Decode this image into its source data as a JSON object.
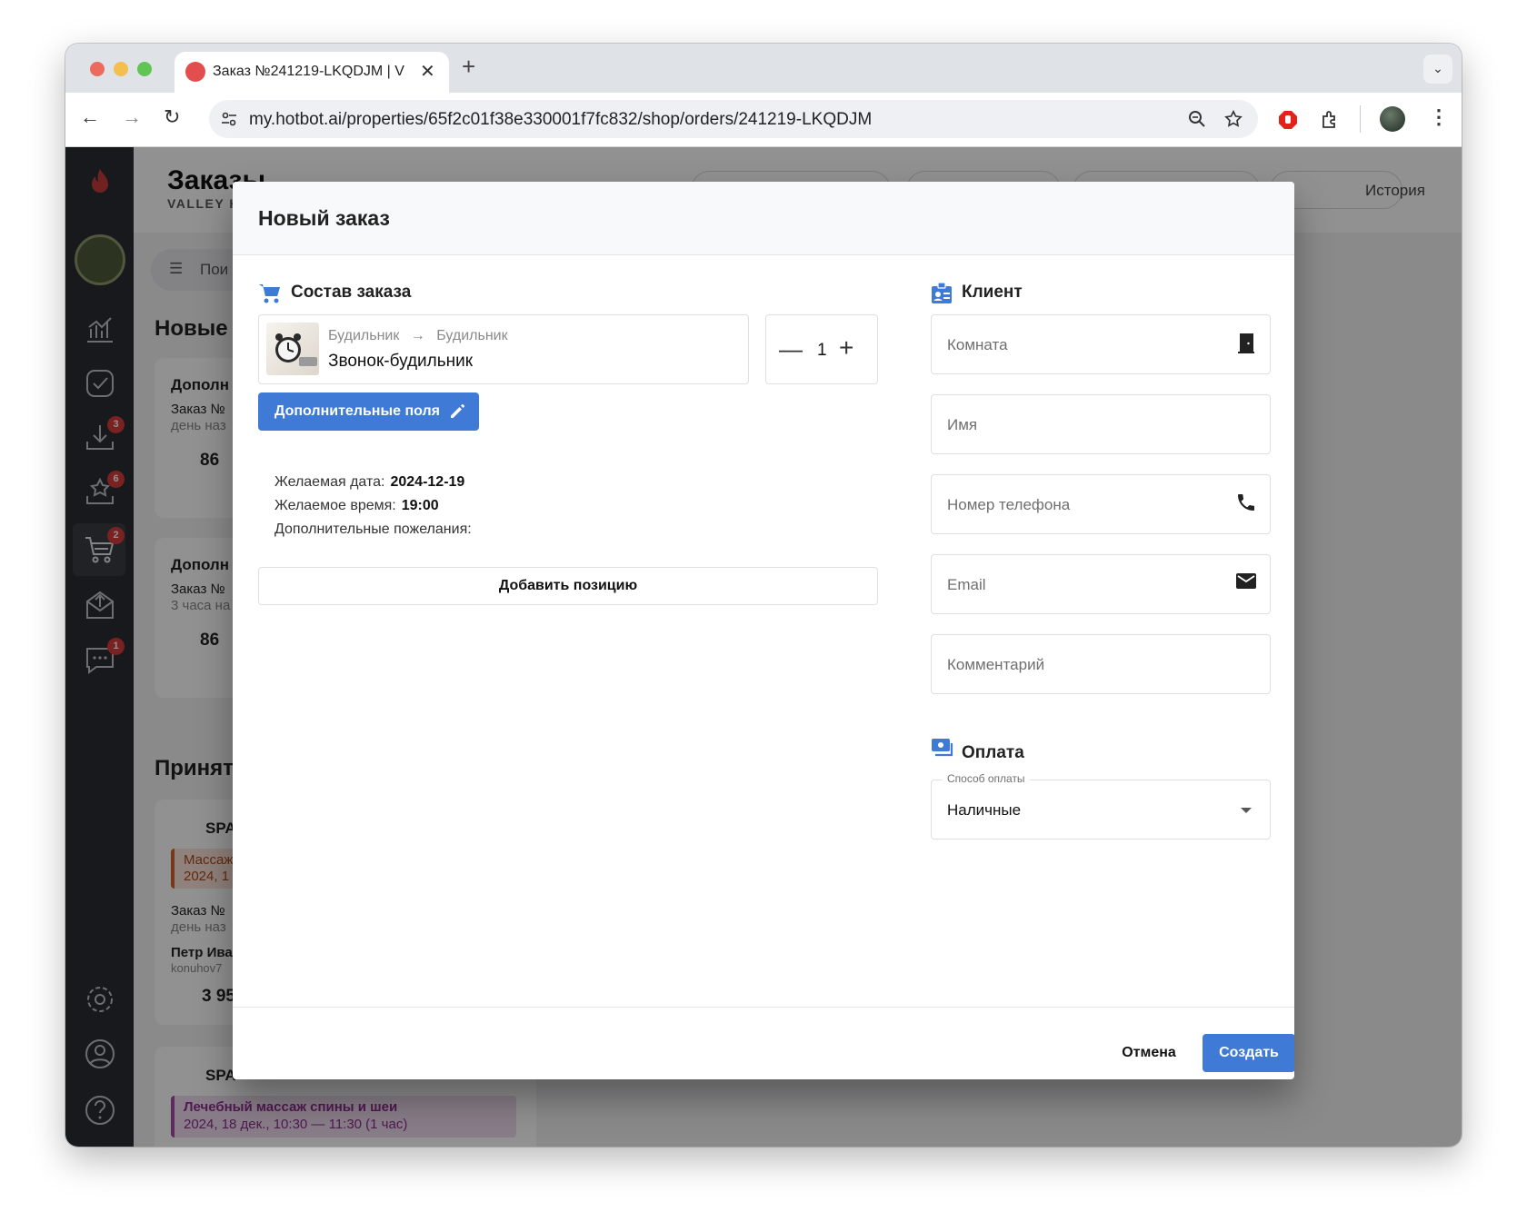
{
  "browser": {
    "tab_title": "Заказ №241219-LKQDJM | V",
    "url": "my.hotbot.ai/properties/65f2c01f38e330001f7fc832/shop/orders/241219-LKQDJM"
  },
  "sidebar": {
    "badges": {
      "inbox": "3",
      "reviews": "6",
      "shop": "2",
      "chat": "1"
    }
  },
  "background": {
    "title": "Заказы",
    "subtitle": "VALLEY H",
    "history_label": "История",
    "search_label": "Пои",
    "section_new": "Новые",
    "section_accepted": "Приняты",
    "card1_title": "Дополн",
    "card1_line1": "Заказ №",
    "card1_line2": "день наз",
    "card1_room": "86",
    "card2_title": "Дополн",
    "card2_line1": "Заказ №",
    "card2_line2": "3 часа на",
    "card2_room": "86",
    "card3_title": "SPA",
    "card3_service": "Массаж",
    "card3_date": "2024, 1",
    "card3_line1": "Заказ №",
    "card3_line2": "день наз",
    "card3_person": "Петр Ива",
    "card3_email": "konuhov7",
    "card3_price": "3 95",
    "card4_title": "SPA",
    "card4_service": "Лечебный массаж спины и шеи",
    "card4_date": "2024, 18 дек., 10:30 — 11:30  (1 час)"
  },
  "dialog": {
    "title": "Новый заказ",
    "order_section": "Состав заказа",
    "item": {
      "category": "Будильник",
      "subcategory": "Будильник",
      "arrow": "→",
      "name": "Звонок-будильник",
      "quantity": "1"
    },
    "extra_fields_button": "Дополнительные поля",
    "desired_date_label": "Желаемая дата:",
    "desired_date_value": "2024-12-19",
    "desired_time_label": "Желаемое время:",
    "desired_time_value": "19:00",
    "wishes_label": "Дополнительные пожелания:",
    "add_item_button": "Добавить позицию",
    "client_section": "Клиент",
    "fields": {
      "room": "Комната",
      "name": "Имя",
      "phone": "Номер телефона",
      "email": "Email",
      "comment": "Комментарий"
    },
    "payment_section": "Оплата",
    "payment_method_label": "Способ оплаты",
    "payment_method_value": "Наличные",
    "cancel_button": "Отмена",
    "create_button": "Создать"
  },
  "colors": {
    "accent": "#3f7ad6",
    "sidebar": "#2b2d33",
    "badge": "#d63a3a",
    "section_icon": "#3f7ad6"
  }
}
